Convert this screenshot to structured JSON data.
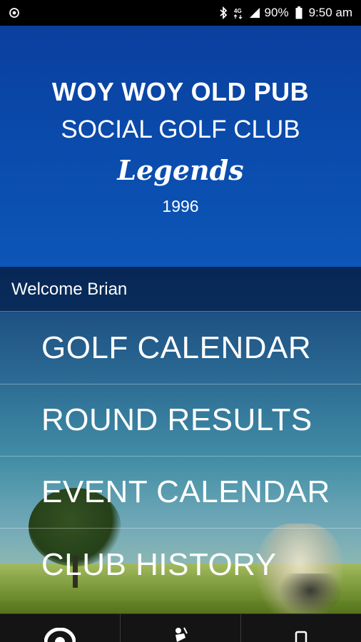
{
  "status_bar": {
    "battery": "90%",
    "time": "9:50 am"
  },
  "header": {
    "line1": "WOY WOY OLD PUB",
    "line2": "SOCIAL GOLF CLUB",
    "legends": "Legends",
    "year": "1996"
  },
  "welcome": "Welcome Brian",
  "menu": [
    {
      "label": "GOLF CALENDAR"
    },
    {
      "label": "ROUND RESULTS"
    },
    {
      "label": "EVENT CALENDAR"
    },
    {
      "label": "CLUB HISTORY"
    }
  ],
  "icons": {
    "status_left": "sync-icon",
    "bluetooth": "bluetooth-icon",
    "network": "4g-icon",
    "signal": "signal-icon",
    "battery": "battery-icon",
    "nav": [
      "home-icon",
      "golfer-icon",
      "phone-icon"
    ]
  },
  "colors": {
    "header_blue": "#0a4aaa",
    "welcome_bar": "#06214e",
    "nav_bg": "#141414"
  }
}
